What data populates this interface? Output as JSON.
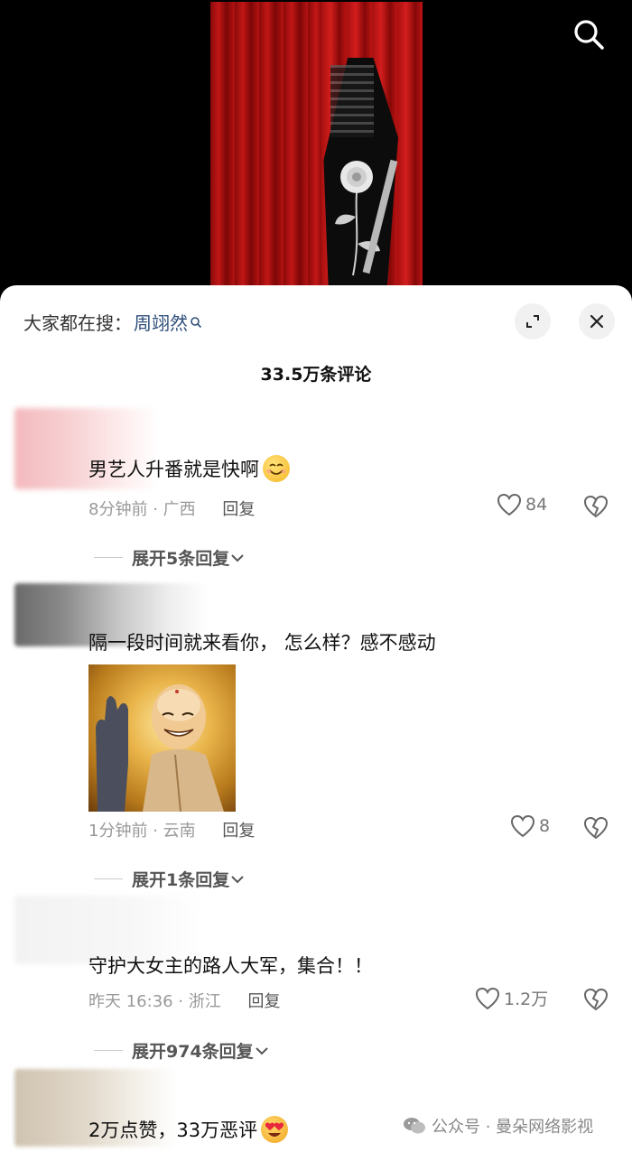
{
  "header": {
    "hot_search_prefix": "大家都在搜：",
    "hot_search_keyword": "周翊然"
  },
  "comment_count": "33.5万条评论",
  "comments": [
    {
      "text": "男艺人升番就是快啊",
      "time": "8分钟前",
      "location": "广西",
      "reply_label": "回复",
      "likes": "84",
      "expand_replies": "展开5条回复",
      "emoji": "smiling-face-emoji"
    },
    {
      "text": "隔一段时间就来看你， 怎么样？感不感动",
      "time": "1分钟前",
      "location": "云南",
      "reply_label": "回复",
      "likes": "8",
      "expand_replies": "展开1条回复",
      "image": "meme-laughing-monk-waving"
    },
    {
      "text": "守护大女主的路人大军，集合！！",
      "time": "昨天 16:36",
      "location": "浙江",
      "reply_label": "回复",
      "likes": "1.2万",
      "expand_replies": "展开974条回复"
    },
    {
      "text": "2万点赞，33万恶评",
      "emoji": "heart-eyes-emoji"
    }
  ],
  "watermark": "公众号 · 曼朵网络影视",
  "colors": {
    "keyword": "#2f4f7a",
    "meta": "#999999",
    "text": "#111111",
    "poster_red": "#b51212"
  }
}
